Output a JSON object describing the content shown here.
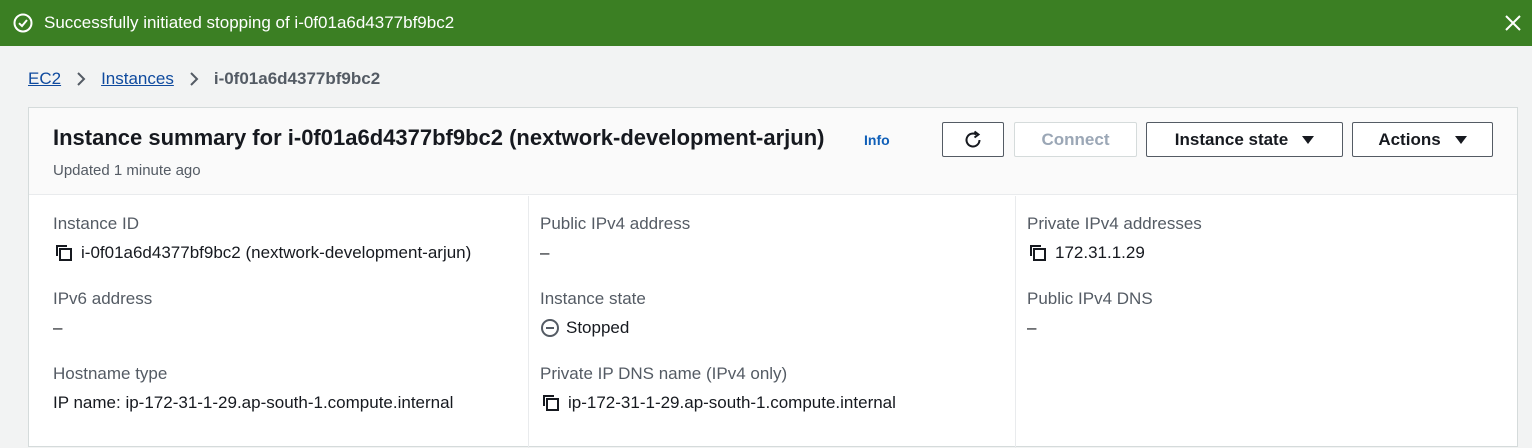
{
  "flash": {
    "message": "Successfully initiated stopping of i-0f01a6d4377bf9bc2",
    "color": "#3b7f23"
  },
  "breadcrumb": {
    "items": [
      "EC2",
      "Instances"
    ],
    "current": "i-0f01a6d4377bf9bc2"
  },
  "summary": {
    "title": "Instance summary for i-0f01a6d4377bf9bc2 (nextwork-development-arjun)",
    "info": "Info",
    "updated": "Updated 1 minute ago"
  },
  "toolbar": {
    "connect": "Connect",
    "instance_state": "Instance state",
    "actions": "Actions"
  },
  "details": {
    "instance_id": {
      "label": "Instance ID",
      "value": "i-0f01a6d4377bf9bc2 (nextwork-development-arjun)"
    },
    "public_ipv4": {
      "label": "Public IPv4 address",
      "value": "–"
    },
    "private_ipv4": {
      "label": "Private IPv4 addresses",
      "value": "172.31.1.29"
    },
    "ipv6": {
      "label": "IPv6 address",
      "value": "–"
    },
    "instance_state": {
      "label": "Instance state",
      "value": "Stopped"
    },
    "public_dns": {
      "label": "Public IPv4 DNS",
      "value": "–"
    },
    "hostname_type": {
      "label": "Hostname type",
      "value": "IP name: ip-172-31-1-29.ap-south-1.compute.internal"
    },
    "private_dns": {
      "label": "Private IP DNS name (IPv4 only)",
      "value": "ip-172-31-1-29.ap-south-1.compute.internal"
    }
  }
}
